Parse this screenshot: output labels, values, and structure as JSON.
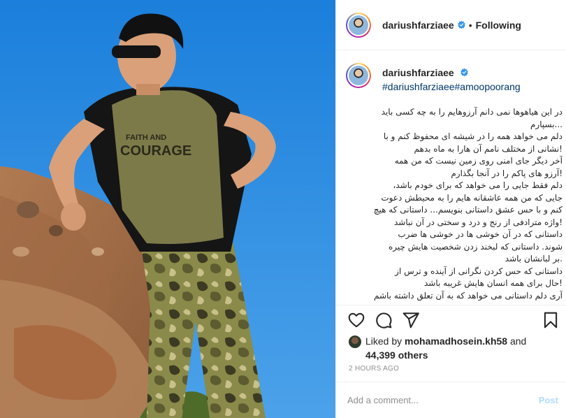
{
  "header": {
    "username": "dariushfarziaee",
    "separator": "•",
    "follow_label": "Following"
  },
  "caption": {
    "username": "dariushfarziaee",
    "hashtags": [
      "#dariushfarziaee",
      "#amoopoorang"
    ],
    "lines": [
      "در این هیاهوها نمی دانم آرزوهایم را به چه کسی باید",
      "...بسپارم",
      "دلم می خواهد همه را در شیشه ای محفوظ کنم و با",
      "!نشانی از مختلف نامم آن هارا به ماه بدهم",
      "آخر دیگر جای امنی روی زمین نیست که من همه",
      "!آرزو های پاکم را در آنجا بگذارم",
      "دلم فقط جایی را می خواهد که برای خودم باشد،",
      "جایی که من همه عاشقانه هایم را به محیطش دعوت",
      "کنم و با حس عشق داستانی بنویسم... داستانی که هیچ",
      "!واژه مترادفی از رنج و درد و سختی در آن نباشد",
      "داستانی که در آن خوشی ها در خوشی ها ضرب",
      "شوند. داستانی که لبخند زدن شخصیت هایش چیره",
      ".بر لبانشان باشد",
      "داستانی که حس کردن نگرانی از آینده و ترس از",
      "!حال برای همه انسان هایش غریبه باشد",
      "آری دلم داستانی می خواهد که به آن تعلق داشته باشم"
    ]
  },
  "actions": {
    "like_icon": "heart-icon",
    "comment_icon": "comment-icon",
    "share_icon": "share-icon",
    "save_icon": "bookmark-icon"
  },
  "likes": {
    "prefix": "Liked by",
    "user": "mohamadhosein.kh58",
    "and": "and",
    "count": "44,399 others"
  },
  "timestamp": "2 HOURS AGO",
  "comment": {
    "placeholder": "Add a comment...",
    "post_label": "Post"
  },
  "colors": {
    "verified_blue": "#3897f0",
    "hashtag": "#00376b",
    "post_disabled": "#b3dbff",
    "sky": "#2f8fe5"
  }
}
